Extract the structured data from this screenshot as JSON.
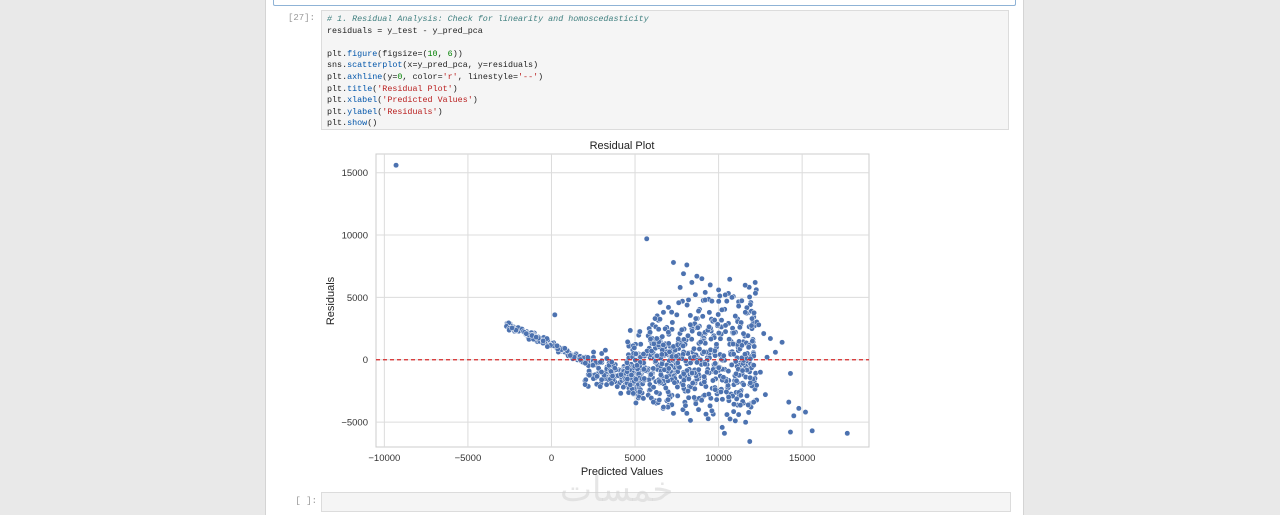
{
  "cells": {
    "code_cell": {
      "prompt": "[27]:",
      "lines": [
        "# 1. Residual Analysis: Check for linearity and homoscedasticity",
        "residuals = y_test - y_pred_pca",
        "",
        "plt.figure(figsize=(10, 6))",
        "sns.scatterplot(x=y_pred_pca, y=residuals)",
        "plt.axhline(y=0, color='r', linestyle='--')",
        "plt.title('Residual Plot')",
        "plt.xlabel('Predicted Values')",
        "plt.ylabel('Residuals')",
        "plt.show()"
      ]
    },
    "empty_cell": {
      "prompt": "[ ]:"
    }
  },
  "watermark": "خمسات",
  "chart_data": {
    "type": "scatter",
    "title": "Residual Plot",
    "xlabel": "Predicted Values",
    "ylabel": "Residuals",
    "xlim": [
      -10500,
      19000
    ],
    "ylim": [
      -7000,
      16500
    ],
    "xticks": [
      -10000,
      -5000,
      0,
      5000,
      10000,
      15000
    ],
    "yticks": [
      -5000,
      0,
      5000,
      10000,
      15000
    ],
    "xtick_labels": [
      "−10000",
      "−5000",
      "0",
      "5000",
      "10000",
      "15000"
    ],
    "ytick_labels": [
      "−5000",
      "0",
      "5000",
      "10000",
      "15000"
    ],
    "grid": true,
    "reference_line": {
      "y": 0,
      "style": "dashed",
      "color": "#d62728"
    },
    "point_color": "#4c72b0",
    "points": [
      [
        -9300,
        15600
      ],
      [
        5700,
        9700
      ],
      [
        7300,
        7800
      ],
      [
        8100,
        7600
      ],
      [
        7900,
        6900
      ],
      [
        8700,
        6700
      ],
      [
        9000,
        6500
      ],
      [
        9500,
        6000
      ],
      [
        8400,
        6200
      ],
      [
        7700,
        5800
      ],
      [
        10000,
        5600
      ],
      [
        9200,
        5400
      ],
      [
        10400,
        5200
      ],
      [
        10800,
        5000
      ],
      [
        6500,
        4600
      ],
      [
        7000,
        4200
      ],
      [
        8200,
        4800
      ],
      [
        9600,
        4700
      ],
      [
        11200,
        4300
      ],
      [
        11600,
        3800
      ],
      [
        12000,
        3300
      ],
      [
        12400,
        2800
      ],
      [
        6200,
        3300
      ],
      [
        6700,
        3800
      ],
      [
        7500,
        3600
      ],
      [
        8800,
        3900
      ],
      [
        10200,
        4000
      ],
      [
        11000,
        3500
      ],
      [
        200,
        3600
      ],
      [
        13800,
        1400
      ],
      [
        13400,
        600
      ],
      [
        14300,
        -1100
      ],
      [
        14200,
        -3400
      ],
      [
        14800,
        -3900
      ],
      [
        15200,
        -4200
      ],
      [
        14500,
        -4500
      ],
      [
        14300,
        -5800
      ],
      [
        15600,
        -5700
      ],
      [
        17700,
        -5900
      ],
      [
        12800,
        -2800
      ],
      [
        12100,
        -3400
      ],
      [
        11200,
        -4400
      ],
      [
        10500,
        -4400
      ],
      [
        11000,
        -4900
      ],
      [
        9600,
        -4100
      ],
      [
        8800,
        -4000
      ],
      [
        8100,
        -4300
      ],
      [
        7300,
        -4300
      ],
      [
        6700,
        -3800
      ],
      [
        6100,
        -3400
      ],
      [
        5500,
        -3100
      ],
      [
        4900,
        -2700
      ],
      [
        4300,
        -2200
      ],
      [
        3600,
        -1900
      ],
      [
        3000,
        -1600
      ],
      [
        10600,
        -3000
      ],
      [
        11500,
        -2000
      ],
      [
        12500,
        -1000
      ],
      [
        12900,
        200
      ],
      [
        13100,
        1700
      ],
      [
        12700,
        2100
      ],
      [
        11800,
        1000
      ],
      [
        9800,
        -2400
      ],
      [
        5900,
        2200
      ],
      [
        6300,
        1700
      ]
    ]
  }
}
